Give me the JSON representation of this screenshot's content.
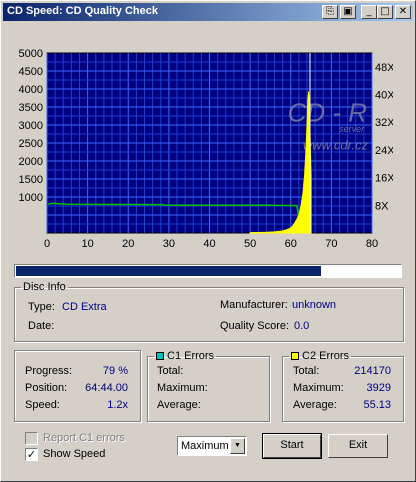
{
  "window": {
    "title": "CD Speed: CD Quality Check",
    "buttons": [
      "copy-icon",
      "save-icon",
      "minimize-icon",
      "maximize-icon",
      "close-icon"
    ]
  },
  "chart_data": {
    "type": "line",
    "title": "",
    "xlabel": "",
    "ylabel": "",
    "xlim": [
      0,
      80
    ],
    "ylim": [
      0,
      5000
    ],
    "y2lim": [
      0,
      52
    ],
    "x_ticks": [
      "0",
      "10",
      "20",
      "30",
      "40",
      "50",
      "60",
      "70",
      "80"
    ],
    "y_ticks": [
      "1000",
      "1500",
      "2000",
      "2500",
      "3000",
      "3500",
      "4000",
      "4500",
      "5000"
    ],
    "y2_ticks": [
      "8X",
      "16X",
      "24X",
      "32X",
      "40X",
      "48X"
    ],
    "grid": true,
    "background": "#000080",
    "watermark": {
      "line1": "CD - R",
      "line2": "server",
      "url": "www.cdr.cz"
    },
    "current_position_marker_x": 64.73,
    "series": [
      {
        "color": "#00c000",
        "axis": "speed",
        "points": [
          [
            0.3,
            8.3
          ],
          [
            1.5,
            8.6
          ],
          [
            2.5,
            8.5
          ],
          [
            5,
            8.3
          ],
          [
            28.5,
            8.2
          ],
          [
            29.5,
            8.0
          ],
          [
            55,
            8.0
          ],
          [
            61.5,
            7.9
          ],
          [
            62.5,
            0.5
          ],
          [
            64.7,
            0.4
          ]
        ]
      },
      {
        "color": "#ffff00",
        "axis": "errors",
        "points": [
          [
            50,
            10
          ],
          [
            52,
            15
          ],
          [
            54,
            20
          ],
          [
            56,
            30
          ],
          [
            58,
            60
          ],
          [
            59,
            90
          ],
          [
            60,
            140
          ],
          [
            60.5,
            200
          ],
          [
            61,
            280
          ],
          [
            61.5,
            380
          ],
          [
            62,
            500
          ],
          [
            62.5,
            750
          ],
          [
            63,
            1100
          ],
          [
            63.4,
            1600
          ],
          [
            63.7,
            2200
          ],
          [
            64,
            3000
          ],
          [
            64.2,
            3700
          ],
          [
            64.4,
            3929
          ],
          [
            64.6,
            3500
          ],
          [
            64.8,
            2500
          ],
          [
            65,
            1600
          ]
        ]
      }
    ]
  },
  "progress_bar": {
    "fraction": 0.79
  },
  "disc_info": {
    "group_label": "Disc Info",
    "type_label": "Type:",
    "type_value": "CD Extra",
    "date_label": "Date:",
    "date_value": "",
    "manufacturer_label": "Manufacturer:",
    "manufacturer_value": "unknown",
    "quality_label": "Quality Score:",
    "quality_value": "0.0"
  },
  "status": {
    "progress_label": "Progress:",
    "progress_value": "79 %",
    "position_label": "Position:",
    "position_value": "64:44.00",
    "speed_label": "Speed:",
    "speed_value": "1.2x"
  },
  "c1": {
    "group_label": "C1 Errors",
    "swatch_color": "#00c0c0",
    "total_label": "Total:",
    "total_value": "",
    "maximum_label": "Maximum:",
    "maximum_value": "",
    "average_label": "Average:",
    "average_value": ""
  },
  "c2": {
    "group_label": "C2 Errors",
    "swatch_color": "#ffff00",
    "total_label": "Total:",
    "total_value": "214170",
    "maximum_label": "Maximum:",
    "maximum_value": "3929",
    "average_label": "Average:",
    "average_value": "55.13"
  },
  "controls": {
    "report_c1_label": "Report C1 errors",
    "report_c1_checked": false,
    "show_speed_label": "Show Speed",
    "show_speed_checked": true,
    "mode_select_value": "Maximum",
    "start_label": "Start",
    "exit_label": "Exit"
  }
}
